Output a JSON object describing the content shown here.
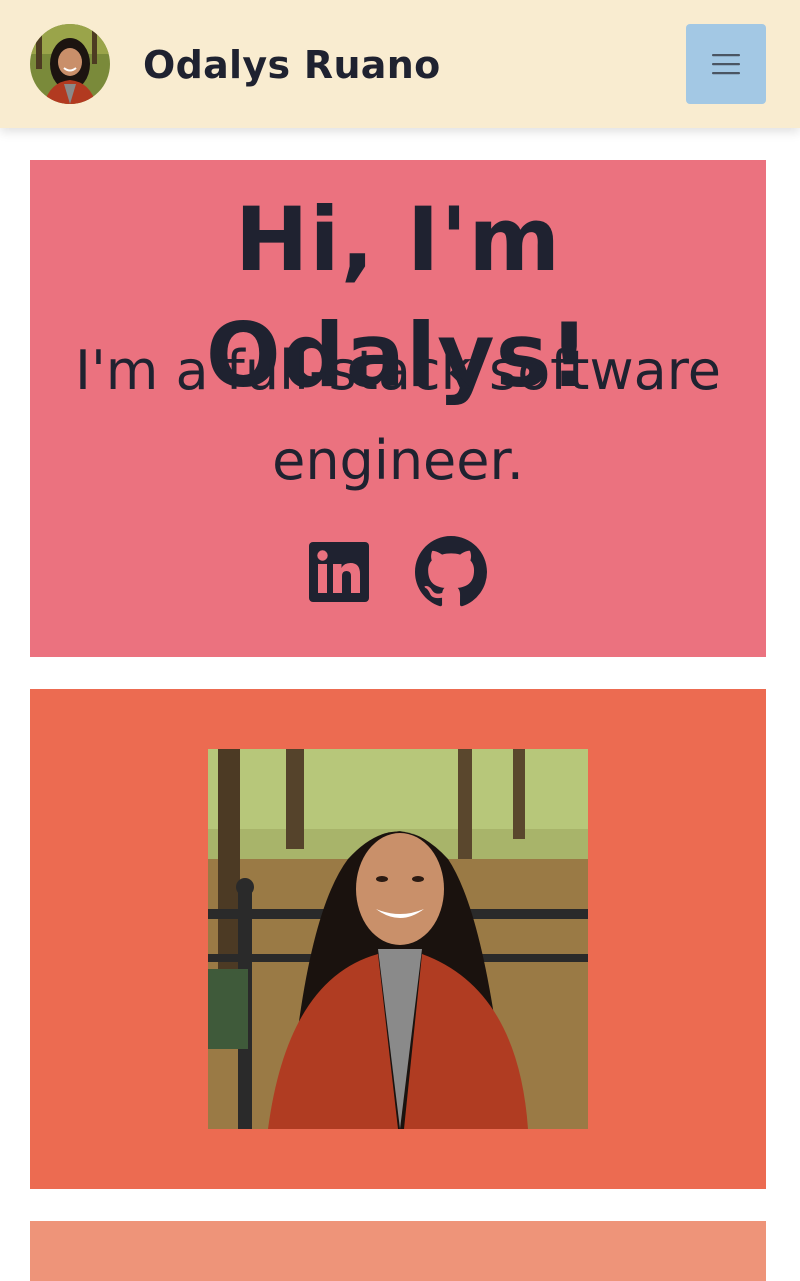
{
  "nav": {
    "brand_name": "Odalys Ruano",
    "avatar_icon": "avatar-photo",
    "menu_icon": "hamburger-menu-icon"
  },
  "hero": {
    "heading": "Hi, I'm Odalys!",
    "tagline": "I'm a full-stack software engineer.",
    "social_links": [
      {
        "name": "LinkedIn",
        "icon": "linkedin-icon"
      },
      {
        "name": "GitHub",
        "icon": "github-icon"
      }
    ]
  },
  "about": {
    "photo_icon": "portrait-photo"
  },
  "colors": {
    "navbar_bg": "#f9ecd0",
    "menu_button_bg": "#a3c8e4",
    "hero_bg": "#eb727f",
    "photo_section_bg": "#ec6b51",
    "next_section_bg": "#ee9479",
    "text": "#1f2230"
  }
}
